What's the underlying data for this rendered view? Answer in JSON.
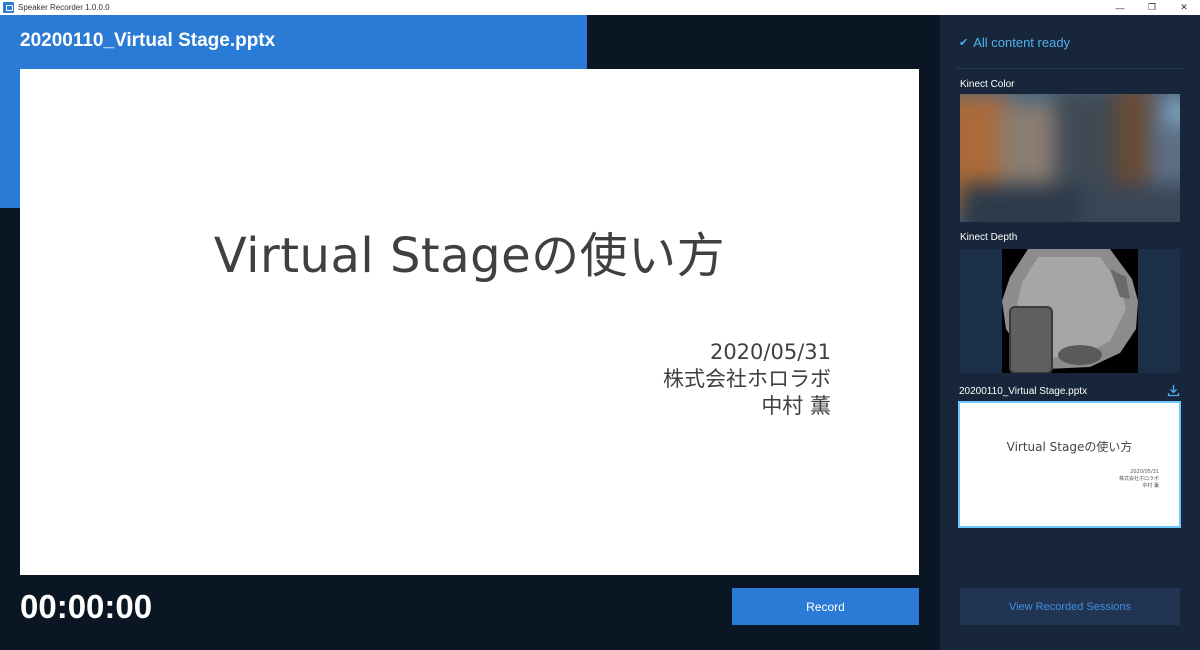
{
  "window": {
    "title": "Speaker Recorder 1.0.0.0",
    "controls": {
      "minimize": "—",
      "restore": "❐",
      "close": "✕"
    }
  },
  "main": {
    "file_title": "20200110_Virtual Stage.pptx",
    "slide": {
      "title": "Virtual Stageの使い方",
      "date": "2020/05/31",
      "company": "株式会社ホロラボ",
      "author": "中村 薫"
    },
    "timer": "00:00:00",
    "record_label": "Record"
  },
  "panel": {
    "status": "All content ready",
    "kinect_color_label": "Kinect Color",
    "kinect_depth_label": "Kinect Depth",
    "pptx_label": "20200110_Virtual Stage.pptx",
    "thumb": {
      "title": "Virtual Stageの使い方",
      "date": "2020/05/31",
      "company": "株式会社ホロラボ",
      "author": "中村 薫"
    },
    "view_sessions_label": "View Recorded Sessions"
  },
  "colors": {
    "accent": "#2a7bd6",
    "background": "#0b1624",
    "panel": "#17263a",
    "status": "#4fb0f0"
  },
  "icons": {
    "status": "check-icon",
    "download": "download-icon",
    "app": "app-icon"
  }
}
